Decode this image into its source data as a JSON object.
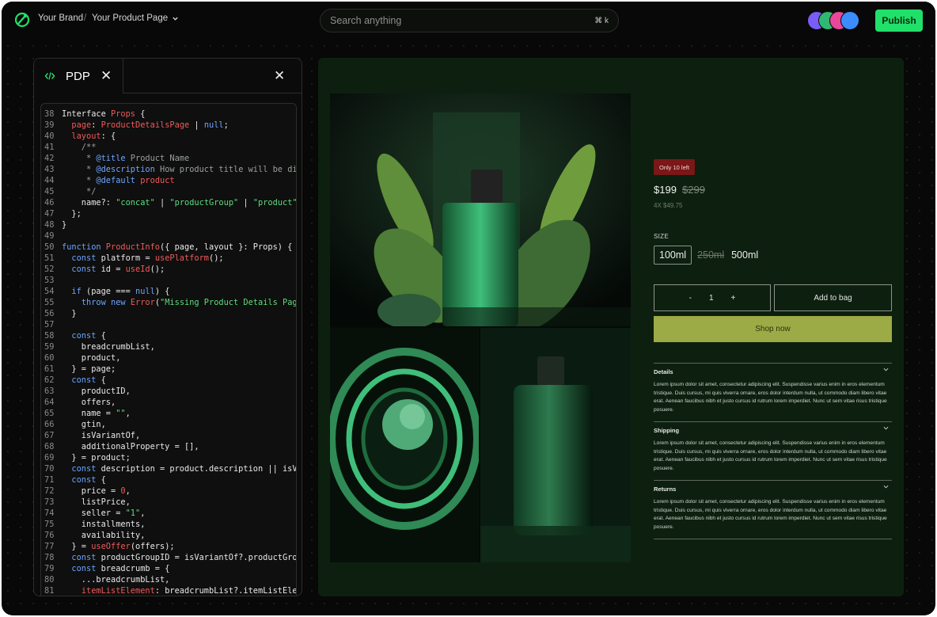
{
  "topbar": {
    "brand": "Your Brand",
    "separator": "/",
    "page": "Your Product Page",
    "search_placeholder": "Search anything",
    "search_shortcut": "⌘ k",
    "publish_label": "Publish",
    "avatar_colors": [
      "#7b5cf6",
      "#2fb872",
      "#e8479a",
      "#3b8dff"
    ]
  },
  "editor": {
    "tab_label": "PDP",
    "lines": [
      {
        "n": "38",
        "tokens": [
          [
            "t",
            "Interface "
          ],
          [
            "r",
            "Props"
          ],
          [
            "t",
            " {"
          ]
        ]
      },
      {
        "n": "39",
        "tokens": [
          [
            "t",
            "  "
          ],
          [
            "r",
            "page"
          ],
          [
            "t",
            ": "
          ],
          [
            "r",
            "ProductDetailsPage"
          ],
          [
            "t",
            " | "
          ],
          [
            "b",
            "null"
          ],
          [
            "t",
            ";"
          ]
        ]
      },
      {
        "n": "40",
        "tokens": [
          [
            "t",
            "  "
          ],
          [
            "r",
            "layout"
          ],
          [
            "t",
            ": {"
          ]
        ]
      },
      {
        "n": "41",
        "tokens": [
          [
            "c",
            "    /**"
          ]
        ]
      },
      {
        "n": "42",
        "tokens": [
          [
            "c",
            "     * "
          ],
          [
            "b",
            "@title"
          ],
          [
            "c",
            " Product Name"
          ]
        ]
      },
      {
        "n": "43",
        "tokens": [
          [
            "c",
            "     * "
          ],
          [
            "b",
            "@description"
          ],
          [
            "c",
            " How product title will be disp"
          ]
        ]
      },
      {
        "n": "44",
        "tokens": [
          [
            "c",
            "     * "
          ],
          [
            "b",
            "@default"
          ],
          [
            "c",
            " "
          ],
          [
            "r",
            "product"
          ]
        ]
      },
      {
        "n": "45",
        "tokens": [
          [
            "c",
            "     */"
          ]
        ]
      },
      {
        "n": "46",
        "tokens": [
          [
            "t",
            "    name?: "
          ],
          [
            "g",
            "\"concat\""
          ],
          [
            "t",
            " | "
          ],
          [
            "g",
            "\"productGroup\""
          ],
          [
            "t",
            " | "
          ],
          [
            "g",
            "\"product\""
          ],
          [
            "t",
            ";"
          ]
        ]
      },
      {
        "n": "47",
        "tokens": [
          [
            "t",
            "  };"
          ]
        ]
      },
      {
        "n": "48",
        "tokens": [
          [
            "t",
            "}"
          ]
        ]
      },
      {
        "n": "49",
        "tokens": [
          [
            "t",
            ""
          ]
        ]
      },
      {
        "n": "50",
        "tokens": [
          [
            "b",
            "function "
          ],
          [
            "r",
            "ProductInfo"
          ],
          [
            "t",
            "({ page, layout }: Props) {"
          ]
        ]
      },
      {
        "n": "51",
        "tokens": [
          [
            "t",
            "  "
          ],
          [
            "b",
            "const"
          ],
          [
            "t",
            " platform = "
          ],
          [
            "r",
            "usePlatform"
          ],
          [
            "t",
            "();"
          ]
        ]
      },
      {
        "n": "52",
        "tokens": [
          [
            "t",
            "  "
          ],
          [
            "b",
            "const"
          ],
          [
            "t",
            " id = "
          ],
          [
            "r",
            "useId"
          ],
          [
            "t",
            "();"
          ]
        ]
      },
      {
        "n": "53",
        "tokens": [
          [
            "t",
            ""
          ]
        ]
      },
      {
        "n": "54",
        "tokens": [
          [
            "t",
            "  "
          ],
          [
            "b",
            "if"
          ],
          [
            "t",
            " (page === "
          ],
          [
            "b",
            "null"
          ],
          [
            "t",
            ") {"
          ]
        ]
      },
      {
        "n": "55",
        "tokens": [
          [
            "t",
            "    "
          ],
          [
            "b",
            "throw new "
          ],
          [
            "r",
            "Error"
          ],
          [
            "t",
            "("
          ],
          [
            "g",
            "\"Missing Product Details Page"
          ]
        ]
      },
      {
        "n": "56",
        "tokens": [
          [
            "t",
            "  }"
          ]
        ]
      },
      {
        "n": "57",
        "tokens": [
          [
            "t",
            ""
          ]
        ]
      },
      {
        "n": "58",
        "tokens": [
          [
            "t",
            "  "
          ],
          [
            "b",
            "const"
          ],
          [
            "t",
            " {"
          ]
        ]
      },
      {
        "n": "59",
        "tokens": [
          [
            "t",
            "    breadcrumbList,"
          ]
        ]
      },
      {
        "n": "60",
        "tokens": [
          [
            "t",
            "    product,"
          ]
        ]
      },
      {
        "n": "61",
        "tokens": [
          [
            "t",
            "  } = page;"
          ]
        ]
      },
      {
        "n": "62",
        "tokens": [
          [
            "t",
            "  "
          ],
          [
            "b",
            "const"
          ],
          [
            "t",
            " {"
          ]
        ]
      },
      {
        "n": "63",
        "tokens": [
          [
            "t",
            "    productID,"
          ]
        ]
      },
      {
        "n": "64",
        "tokens": [
          [
            "t",
            "    offers,"
          ]
        ]
      },
      {
        "n": "65",
        "tokens": [
          [
            "t",
            "    name = "
          ],
          [
            "g",
            "\"\""
          ],
          [
            "t",
            ","
          ]
        ]
      },
      {
        "n": "66",
        "tokens": [
          [
            "t",
            "    gtin,"
          ]
        ]
      },
      {
        "n": "67",
        "tokens": [
          [
            "t",
            "    isVariantOf,"
          ]
        ]
      },
      {
        "n": "68",
        "tokens": [
          [
            "t",
            "    additionalProperty = [],"
          ]
        ]
      },
      {
        "n": "69",
        "tokens": [
          [
            "t",
            "  } = product;"
          ]
        ]
      },
      {
        "n": "70",
        "tokens": [
          [
            "t",
            "  "
          ],
          [
            "b",
            "const"
          ],
          [
            "t",
            " description = product.description || isVar"
          ]
        ]
      },
      {
        "n": "71",
        "tokens": [
          [
            "t",
            "  "
          ],
          [
            "b",
            "const"
          ],
          [
            "t",
            " {"
          ]
        ]
      },
      {
        "n": "72",
        "tokens": [
          [
            "t",
            "    price = "
          ],
          [
            "r",
            "0"
          ],
          [
            "t",
            ","
          ]
        ]
      },
      {
        "n": "73",
        "tokens": [
          [
            "t",
            "    listPrice,"
          ]
        ]
      },
      {
        "n": "74",
        "tokens": [
          [
            "t",
            "    seller = "
          ],
          [
            "g",
            "\"1\""
          ],
          [
            "t",
            ","
          ]
        ]
      },
      {
        "n": "75",
        "tokens": [
          [
            "t",
            "    installments,"
          ]
        ]
      },
      {
        "n": "76",
        "tokens": [
          [
            "t",
            "    availability,"
          ]
        ]
      },
      {
        "n": "77",
        "tokens": [
          [
            "t",
            "  } = "
          ],
          [
            "r",
            "useOffer"
          ],
          [
            "t",
            "(offers);"
          ]
        ]
      },
      {
        "n": "78",
        "tokens": [
          [
            "t",
            "  "
          ],
          [
            "b",
            "const"
          ],
          [
            "t",
            " productGroupID = isVariantOf?.productGroup"
          ]
        ]
      },
      {
        "n": "79",
        "tokens": [
          [
            "t",
            "  "
          ],
          [
            "b",
            "const"
          ],
          [
            "t",
            " breadcrumb = {"
          ]
        ]
      },
      {
        "n": "80",
        "tokens": [
          [
            "t",
            "    ...breadcrumbList,"
          ]
        ]
      },
      {
        "n": "81",
        "tokens": [
          [
            "t",
            "    "
          ],
          [
            "r",
            "itemListElement"
          ],
          [
            "t",
            ": breadcrumbList?.itemListEleme"
          ]
        ]
      }
    ]
  },
  "product": {
    "badge": "Only 10 left",
    "price": "$199",
    "list_price": "$299",
    "installments": "4X $49.75",
    "size_label": "SIZE",
    "sizes": [
      {
        "label": "100ml",
        "state": "selected"
      },
      {
        "label": "250ml",
        "state": "unavailable"
      },
      {
        "label": "500ml",
        "state": "available"
      }
    ],
    "qty_minus": "-",
    "qty_value": "1",
    "qty_plus": "+",
    "add_to_bag": "Add to bag",
    "shop_now": "Shop now",
    "accordions": [
      {
        "title": "Details",
        "body": "Lorem ipsum dolor sit amet, consectetur adipiscing elit. Suspendisse varius enim in eros elementum tristique. Duis cursus, mi quis viverra ornare, eros dolor interdum nulla, ut commodo diam libero vitae erat. Aenean faucibus nibh et justo cursus id rutrum lorem imperdiet. Nunc ut sem vitae risus tristique posuere."
      },
      {
        "title": "Shipping",
        "body": "Lorem ipsum dolor sit amet, consectetur adipiscing elit. Suspendisse varius enim in eros elementum tristique. Duis cursus, mi quis viverra ornare, eros dolor interdum nulla, ut commodo diam libero vitae erat. Aenean faucibus nibh et justo cursus id rutrum lorem imperdiet. Nunc ut sem vitae risus tristique posuere."
      },
      {
        "title": "Returns",
        "body": "Lorem ipsum dolor sit amet, consectetur adipiscing elit. Suspendisse varius enim in eros elementum tristique. Duis cursus, mi quis viverra ornare, eros dolor interdum nulla, ut commodo diam libero vitae erat. Aenean faucibus nibh et justo cursus id rutrum lorem imperdiet. Nunc ut sem vitae risus tristique posuere."
      }
    ]
  },
  "colors": {
    "accent_publish": "#21e06a",
    "preview_bg": "#0d200f",
    "shop_now": "#9cab46",
    "badge": "#7a1717"
  }
}
